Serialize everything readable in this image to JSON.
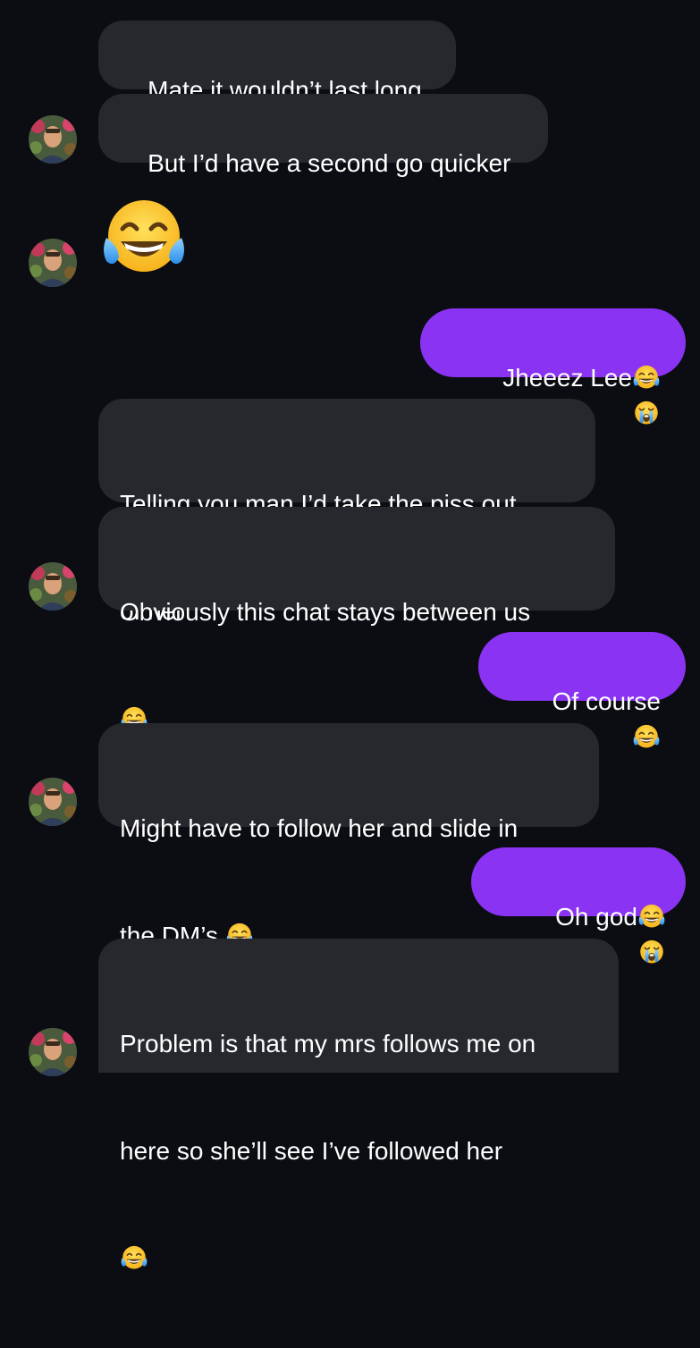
{
  "messages": [
    {
      "id": "m1",
      "direction": "incoming",
      "text": "Mate it wouldn’t last long"
    },
    {
      "id": "m2",
      "direction": "incoming",
      "text": "But I’d have a second go quicker"
    },
    {
      "id": "m3",
      "direction": "incoming",
      "emoji": "face-with-tears-of-joy-icon"
    },
    {
      "id": "m4",
      "direction": "outgoing",
      "text": "Jheeez Lee",
      "emoji_suffix": [
        "face-with-tears-of-joy-icon",
        "loudly-crying-face-icon"
      ]
    },
    {
      "id": "m5",
      "direction": "incoming",
      "lines": [
        "Telling you man I’d take the piss out",
        "of her"
      ]
    },
    {
      "id": "m6",
      "direction": "incoming",
      "lines": [
        "Obviously this chat stays between us"
      ],
      "emoji_suffix": [
        "face-with-tears-of-joy-icon"
      ]
    },
    {
      "id": "m7",
      "direction": "outgoing",
      "text": "Of course",
      "emoji_suffix": [
        "face-with-tears-of-joy-icon"
      ]
    },
    {
      "id": "m8",
      "direction": "incoming",
      "lines": [
        "Might have to follow her and slide in",
        "the DM’s "
      ],
      "emoji_suffix": [
        "face-with-tears-of-joy-icon"
      ]
    },
    {
      "id": "m9",
      "direction": "outgoing",
      "text": "Oh god",
      "emoji_suffix": [
        "face-with-tears-of-joy-icon",
        "loudly-crying-face-icon"
      ]
    },
    {
      "id": "m10",
      "direction": "incoming",
      "lines": [
        "Problem is that my mrs follows me on",
        "here so she’ll see I’ve followed her"
      ],
      "emoji_suffix": [
        "face-with-tears-of-joy-icon"
      ]
    }
  ],
  "colors": {
    "background": "#0b0d12",
    "incoming_bubble": "#26282e",
    "outgoing_bubble": "#8a33f2",
    "text": "#ffffff"
  }
}
